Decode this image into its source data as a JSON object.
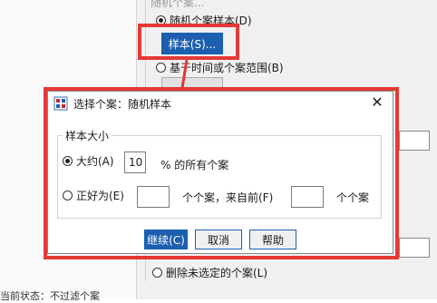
{
  "background": {
    "top_cut_label": "随机个案...",
    "random_sample_option": "随机个案样本(D)",
    "sample_button": "样本(S)...",
    "time_range_option": "基于时间或个案范围(B)",
    "delete_unselected_option": "删除未选定的个案(L)",
    "status_text": "当前状态：不过滤个案"
  },
  "dialog": {
    "title": "选择个案：随机样本",
    "group_label": "样本大小",
    "approx_label": "大约(A)",
    "approx_value": "10",
    "percent_suffix": "% 的所有个案",
    "exact_label": "正好为(E)",
    "cases_from_first": "个个案，来自前(F)",
    "cases_suffix": "个个案",
    "buttons": {
      "continue": "继续(C)",
      "cancel": "取消",
      "help": "帮助"
    }
  },
  "colors": {
    "accent": "#1c5fb0",
    "highlight_red": "#e53935"
  }
}
